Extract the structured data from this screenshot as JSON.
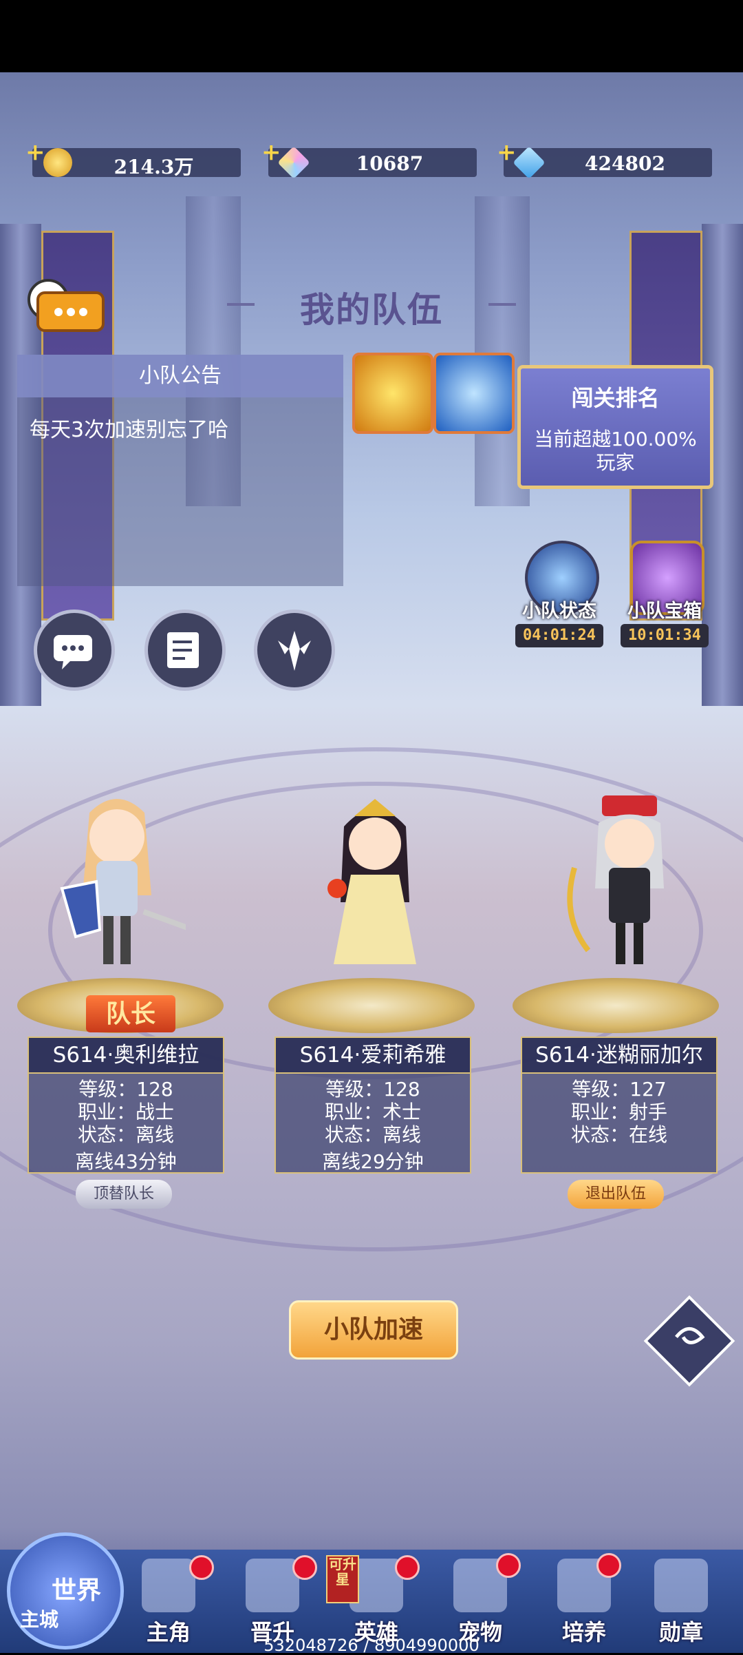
{
  "resources": [
    {
      "value": "214.3万",
      "icon": "gold-coin-icon",
      "color": "#f3c545"
    },
    {
      "value": "10687",
      "icon": "rainbow-crystal-icon",
      "color": "#d8a0f0"
    },
    {
      "value": "424802",
      "icon": "blue-diamond-icon",
      "color": "#4fb0f2"
    }
  ],
  "title": "我的队伍",
  "notice": {
    "header": "小队公告",
    "text": "每天3次加速别忘了哈"
  },
  "rank": {
    "title": "闯关排名",
    "line1": "当前超越100.00%",
    "line2": "玩家"
  },
  "status": [
    {
      "label": "小队状态",
      "timer": "04:01:24"
    },
    {
      "label": "小队宝箱",
      "timer": "10:01:34"
    }
  ],
  "members": [
    {
      "name": "S614·奥利维拉",
      "level": "等级：128",
      "job": "职业：战士",
      "state": "状态：离线",
      "offline": "离线43分钟"
    },
    {
      "name": "S614·爱莉希雅",
      "level": "等级：128",
      "job": "职业：术士",
      "state": "状态：离线",
      "offline": "离线29分钟"
    },
    {
      "name": "S614·迷糊丽加尔",
      "level": "等级：127",
      "job": "职业：射手",
      "state": "状态：在线",
      "offline": ""
    }
  ],
  "leader_tag": "队长",
  "replace_leader": "顶替队长",
  "leave_team": "退出队伍",
  "speed_up": "小队加速",
  "nav": {
    "world_top": "世界",
    "world_bottom": "主城",
    "items": [
      "主角",
      "晋升",
      "英雄",
      "宠物",
      "培养",
      "勋章"
    ],
    "can_upgrade": "可升星"
  },
  "progress": "532048726 / 8904990000"
}
